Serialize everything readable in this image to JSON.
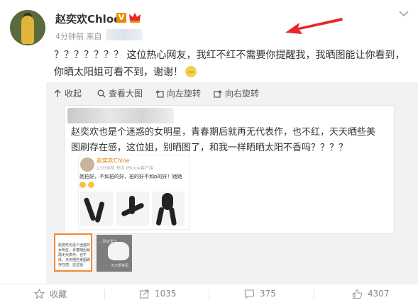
{
  "post": {
    "author": "赵奕欢Chloe",
    "verified_badge": "V",
    "time": "4分钟前",
    "source_label": "来自",
    "text": "？？？？？？？ 这位热心网友，我红不红不需要你提醒我，我晒图能让你看到，你晒太阳姐可看不到，谢谢！"
  },
  "toolbar": {
    "collapse": "收起",
    "view_large": "查看大图",
    "rotate_left": "向左旋转",
    "rotate_right": "向右旋转"
  },
  "image": {
    "caption": "赵奕欢也是个迷惑的女明星，青春期后就再无代表作，也不红，天天晒些美图刷存在感，这位姐，别晒图了，和我一样晒晒太阳不香吗？？？？",
    "nested": {
      "author": "赵奕欢Chloe",
      "meta": "13分钟前 来自 iPhone客户端",
      "text": "她拍好，不如拍的好，拍的好不如p的好！她她"
    }
  },
  "thumbnails": [
    {
      "text": "赵奕欢也是个迷惑的女明星，青春期后就再无代表作，也不红，天天晒些美图刷存在感，这位姐"
    },
    {
      "text_top": "…别太爱了",
      "text_bottom": "天天晒美图"
    }
  ],
  "footer": {
    "favorite": "收藏",
    "repost": "1035",
    "comment": "375",
    "like": "4307"
  },
  "colors": {
    "accent_orange": "#f08a00",
    "annotation_red": "#e8262c",
    "media_bg": "#f2f2f5"
  }
}
